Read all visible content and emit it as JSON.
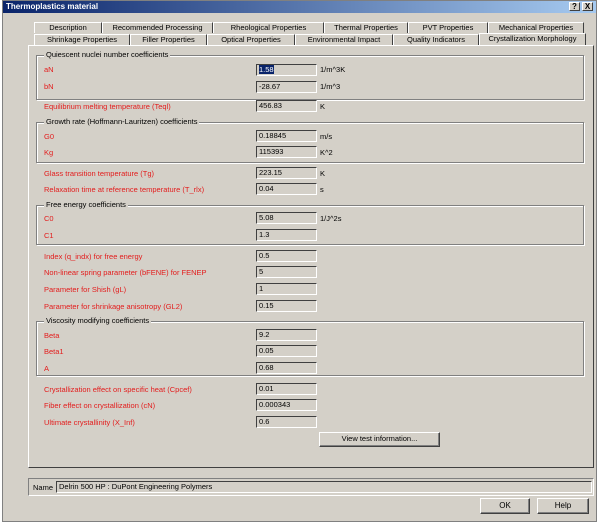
{
  "window": {
    "title": "Thermoplastics material",
    "help_btn": "?",
    "close_btn": "X"
  },
  "tabs_row1": [
    "Description",
    "Recommended Processing",
    "Rheological Properties",
    "Thermal Properties",
    "PVT Properties",
    "Mechanical Properties"
  ],
  "tabs_row2": [
    "Shrinkage Properties",
    "Filler Properties",
    "Optical Properties",
    "Environmental Impact",
    "Quality Indicators",
    "Crystallization Morphology"
  ],
  "active_tab": "Crystallization Morphology",
  "groups": {
    "quiescent": "Quiescent nuclei number coefficients",
    "growth": "Growth rate (Hoffmann-Lauritzen) coefficients",
    "free_energy": "Free energy coefficients",
    "viscosity": "Viscosity modifying coefficients"
  },
  "fields": {
    "aN": {
      "label": "aN",
      "value": "1.58",
      "unit": "1/m^3K"
    },
    "bN": {
      "label": "bN",
      "value": "-28.67",
      "unit": "1/m^3"
    },
    "teql": {
      "label": "Equilibrium melting temperature (Teql)",
      "value": "456.83",
      "unit": "K"
    },
    "g0": {
      "label": "G0",
      "value": "0.18845",
      "unit": "m/s"
    },
    "kg": {
      "label": "Kg",
      "value": "115393",
      "unit": "K^2"
    },
    "tg": {
      "label": "Glass transition temperature (Tg)",
      "value": "223.15",
      "unit": "K"
    },
    "trlx": {
      "label": "Relaxation time at reference temperature (T_rlx)",
      "value": "0.04",
      "unit": "s"
    },
    "c0": {
      "label": "C0",
      "value": "5.08",
      "unit": "1/J^2s"
    },
    "c1": {
      "label": "C1",
      "value": "1.3",
      "unit": ""
    },
    "q_indx": {
      "label": "Index (q_indx) for free energy",
      "value": "0.5",
      "unit": ""
    },
    "bfene": {
      "label": "Non-linear spring parameter (bFENE) for FENEP",
      "value": "5",
      "unit": ""
    },
    "gl": {
      "label": "Parameter for Shish (gL)",
      "value": "1",
      "unit": ""
    },
    "gl2": {
      "label": "Parameter for shrinkage anisotropy (GL2)",
      "value": "0.15",
      "unit": ""
    },
    "beta": {
      "label": "Beta",
      "value": "9.2",
      "unit": ""
    },
    "beta1": {
      "label": "Beta1",
      "value": "0.05",
      "unit": ""
    },
    "a": {
      "label": "A",
      "value": "0.68",
      "unit": ""
    },
    "cpcef": {
      "label": "Crystallization effect on specific heat (Cpcef)",
      "value": "0.01",
      "unit": ""
    },
    "cn": {
      "label": "Fiber effect on crystallization (cN)",
      "value": "0.000343",
      "unit": ""
    },
    "xinf": {
      "label": "Ultimate crystallinity (X_Inf)",
      "value": "0.6",
      "unit": ""
    }
  },
  "view_test_btn": "View test information...",
  "name": {
    "label": "Name",
    "value": "Delrin 500 HP : DuPont Engineering Polymers"
  },
  "buttons": {
    "ok": "OK",
    "help": "Help"
  }
}
